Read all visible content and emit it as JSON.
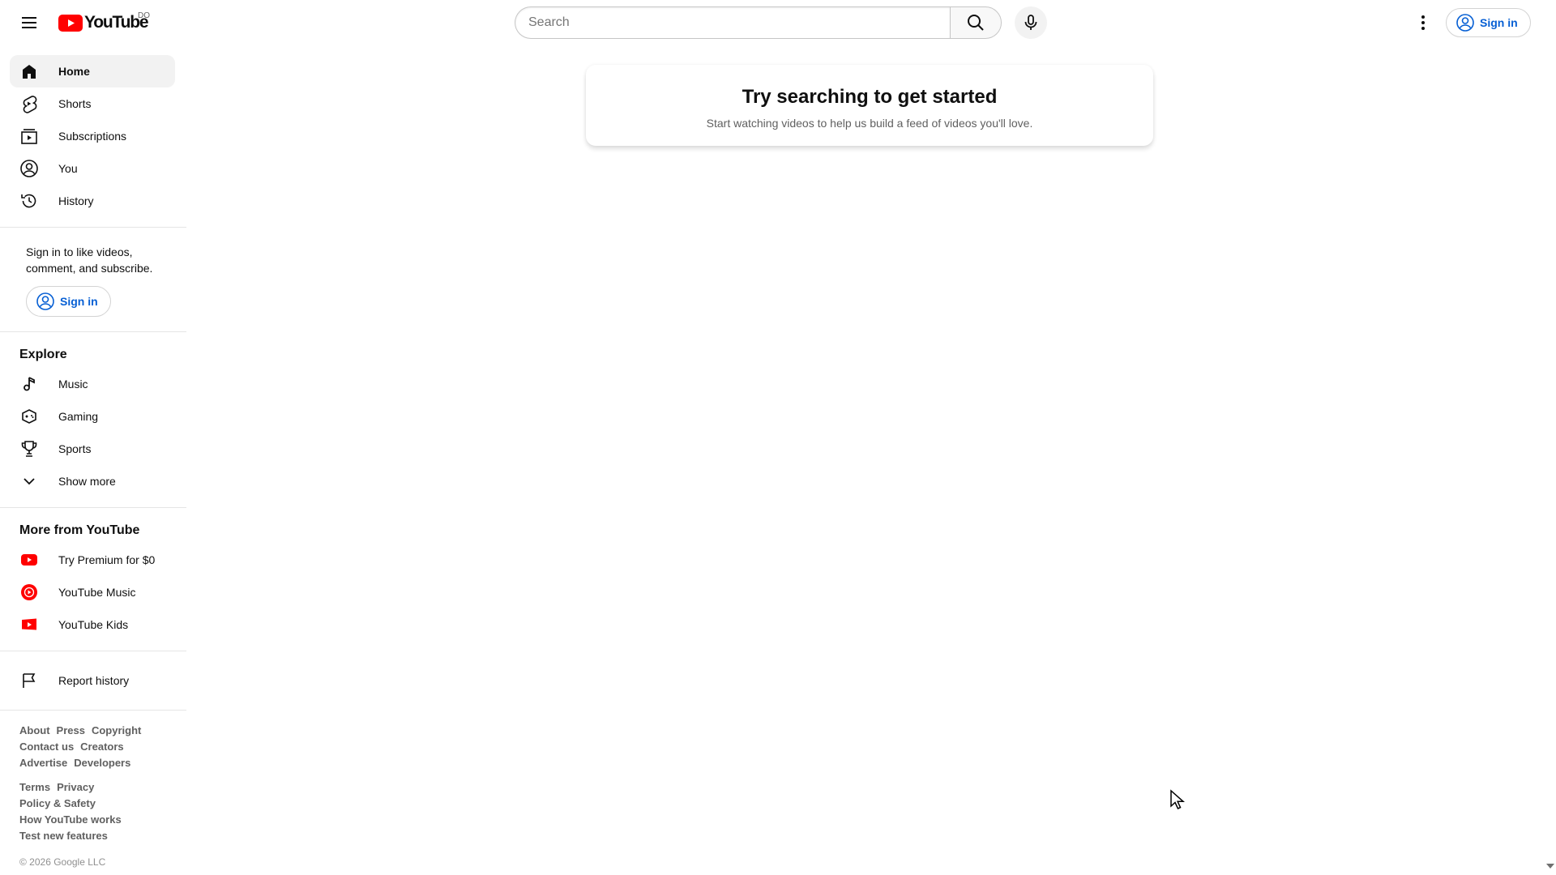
{
  "header": {
    "menu_icon": "hamburger-menu-icon",
    "logo_text": "YouTube",
    "country_code": "DO",
    "search": {
      "placeholder": "Search",
      "value": ""
    },
    "search_icon": "search-icon",
    "mic_icon": "microphone-icon",
    "more_icon": "vertical-dots-icon",
    "sign_in_label": "Sign in"
  },
  "sidebar": {
    "primary": [
      {
        "label": "Home",
        "icon": "home-icon",
        "active": true
      },
      {
        "label": "Shorts",
        "icon": "shorts-icon"
      },
      {
        "label": "Subscriptions",
        "icon": "subscriptions-icon"
      },
      {
        "label": "You",
        "icon": "account-icon"
      },
      {
        "label": "History",
        "icon": "history-icon"
      }
    ],
    "signin_prompt": "Sign in to like videos, comment, and subscribe.",
    "signin_label": "Sign in",
    "explore_title": "Explore",
    "explore": [
      {
        "label": "Music",
        "icon": "music-note-icon"
      },
      {
        "label": "Gaming",
        "icon": "gamepad-icon"
      },
      {
        "label": "Sports",
        "icon": "trophy-icon"
      },
      {
        "label": "Show more",
        "icon": "chevron-down-icon"
      }
    ],
    "more_title": "More from YouTube",
    "more": [
      {
        "label": "Try Premium for $0",
        "icon": "youtube-premium-icon"
      },
      {
        "label": "YouTube Music",
        "icon": "youtube-music-icon"
      },
      {
        "label": "YouTube Kids",
        "icon": "youtube-kids-icon"
      }
    ],
    "report": {
      "label": "Report history",
      "icon": "flag-icon"
    },
    "footer_links_1": [
      "About",
      "Press",
      "Copyright",
      "Contact us",
      "Creators",
      "Advertise",
      "Developers"
    ],
    "footer_links_2": [
      "Terms",
      "Privacy",
      "Policy & Safety",
      "How YouTube works",
      "Test new features"
    ],
    "copyright": "© 2026 Google LLC"
  },
  "main": {
    "empty_title": "Try searching to get started",
    "empty_subtitle": "Start watching videos to help us build a feed of videos you'll love."
  },
  "colors": {
    "brand_red": "#ff0000",
    "link_blue": "#065fd4",
    "text": "#0f0f0f",
    "muted": "#606060"
  }
}
